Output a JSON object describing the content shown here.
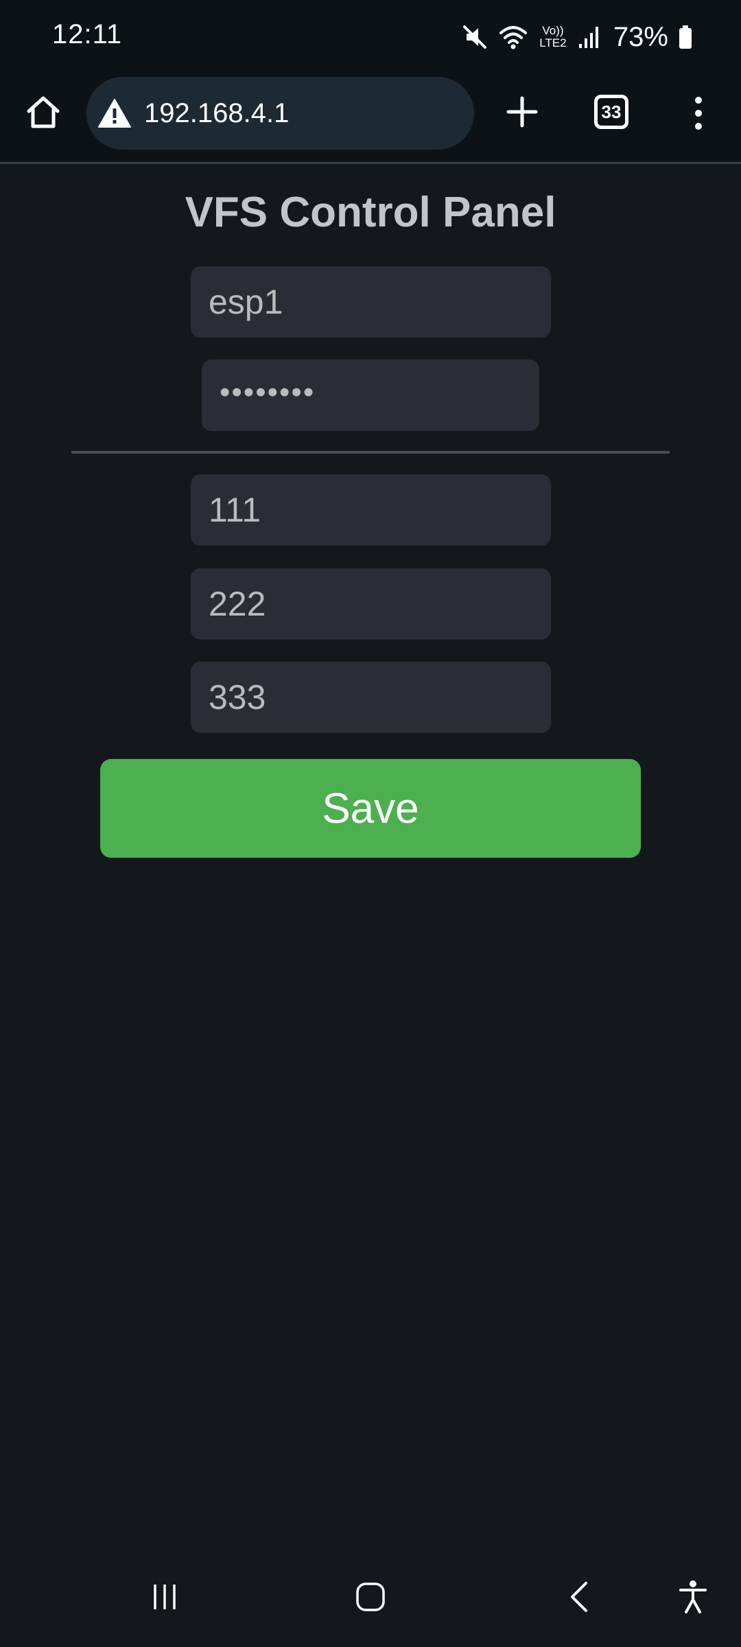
{
  "status_bar": {
    "time": "12:11",
    "network_label": "Vo)) LTE2",
    "battery_percent": "73%",
    "icons": [
      "mute-icon",
      "wifi-icon",
      "volte-lte-icon",
      "signal-icon",
      "battery-icon"
    ]
  },
  "browser": {
    "url": "192.168.4.1",
    "tab_count": "33",
    "icons": [
      "home-icon",
      "warning-icon",
      "plus-icon",
      "tabs-icon",
      "more-vert-icon"
    ]
  },
  "page": {
    "title": "VFS Control Panel",
    "username_value": "esp1",
    "password_value": "••••••••",
    "field_1_value": "111",
    "field_2_value": "222",
    "field_3_value": "333",
    "save_label": "Save",
    "colors": {
      "background": "#14171c",
      "field_bg": "#2a2d35",
      "save_button": "#4caf50",
      "text_muted": "#b9bbbe"
    }
  },
  "nav_bar": {
    "icons": [
      "recents-icon",
      "home-circle-icon",
      "back-icon",
      "accessibility-icon"
    ]
  }
}
